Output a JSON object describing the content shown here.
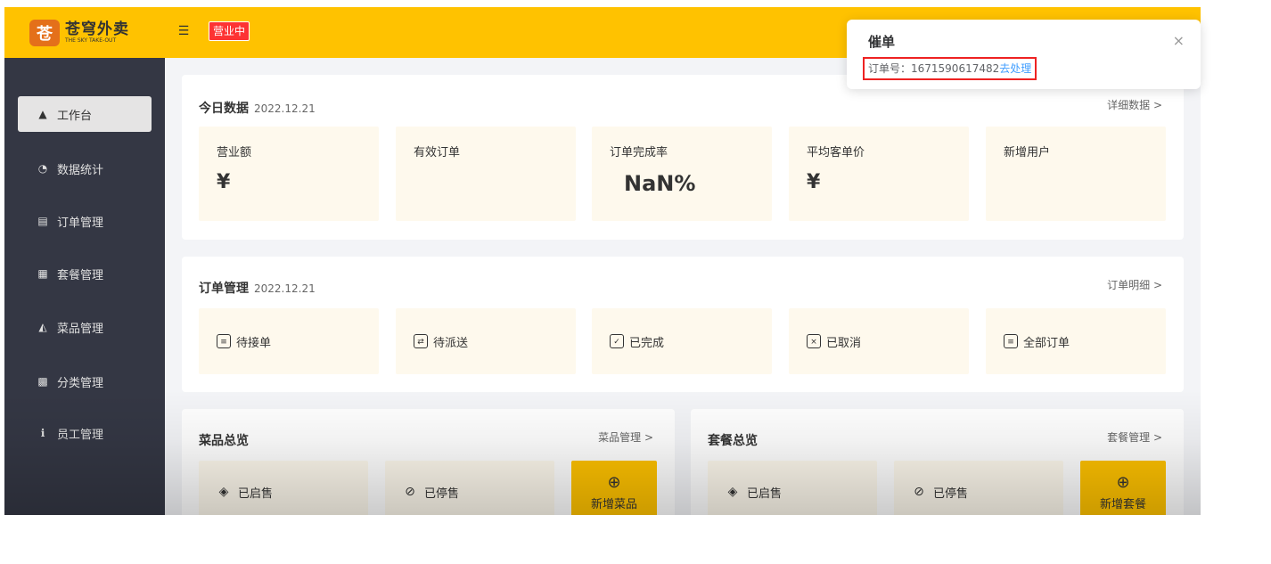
{
  "header": {
    "logo_mark": "苍",
    "logo_cn": "苍穹外卖",
    "logo_en": "THE SKY TAKE-OUT",
    "collapse_icon": "menu-fold-icon",
    "status": "营业中"
  },
  "sidebar": {
    "items": [
      {
        "label": "工作台",
        "icon": "home-icon",
        "glyph": "▲",
        "active": true
      },
      {
        "label": "数据统计",
        "icon": "chart-icon",
        "glyph": "◔"
      },
      {
        "label": "订单管理",
        "icon": "clipboard-icon",
        "glyph": "▤"
      },
      {
        "label": "套餐管理",
        "icon": "gift-icon",
        "glyph": "▦"
      },
      {
        "label": "菜品管理",
        "icon": "dish-icon",
        "glyph": "◭"
      },
      {
        "label": "分类管理",
        "icon": "grid-icon",
        "glyph": "▩"
      },
      {
        "label": "员工管理",
        "icon": "info-icon",
        "glyph": "ℹ"
      }
    ]
  },
  "today": {
    "title": "今日数据",
    "date": "2022.12.21",
    "link": "详细数据 >",
    "tiles": [
      {
        "label": "营业额",
        "value": "¥"
      },
      {
        "label": "有效订单",
        "value": ""
      },
      {
        "label": "订单完成率",
        "value": "NaN%"
      },
      {
        "label": "平均客单价",
        "value": "¥"
      },
      {
        "label": "新增用户",
        "value": ""
      }
    ]
  },
  "orders": {
    "title": "订单管理",
    "date": "2022.12.21",
    "link": "订单明细 >",
    "items": [
      {
        "label": "待接单",
        "icon": "pending-order-icon",
        "glyph": "≡"
      },
      {
        "label": "待派送",
        "icon": "delivery-icon",
        "glyph": "⇄"
      },
      {
        "label": "已完成",
        "icon": "completed-order-icon",
        "glyph": "✓"
      },
      {
        "label": "已取消",
        "icon": "cancelled-order-icon",
        "glyph": "×"
      },
      {
        "label": "全部订单",
        "icon": "all-orders-icon",
        "glyph": "≡"
      }
    ]
  },
  "dishes": {
    "title": "菜品总览",
    "link": "菜品管理 >",
    "on_sale": "已启售",
    "off_sale": "已停售",
    "add_label": "新增菜品",
    "add_glyph": "⊕"
  },
  "setmeals": {
    "title": "套餐总览",
    "link": "套餐管理 >",
    "on_sale": "已启售",
    "off_sale": "已停售",
    "add_label": "新增套餐",
    "add_glyph": "⊕"
  },
  "notification": {
    "title": "催单",
    "message": "订单号：1671590617482",
    "action": "去处理",
    "close_glyph": "×"
  },
  "colors": {
    "brand": "#ffc200",
    "sidebar": "#343744",
    "badge": "#fd3333",
    "tile": "#fef9ed",
    "link": "#419eff",
    "highlight": "#ee2222"
  }
}
